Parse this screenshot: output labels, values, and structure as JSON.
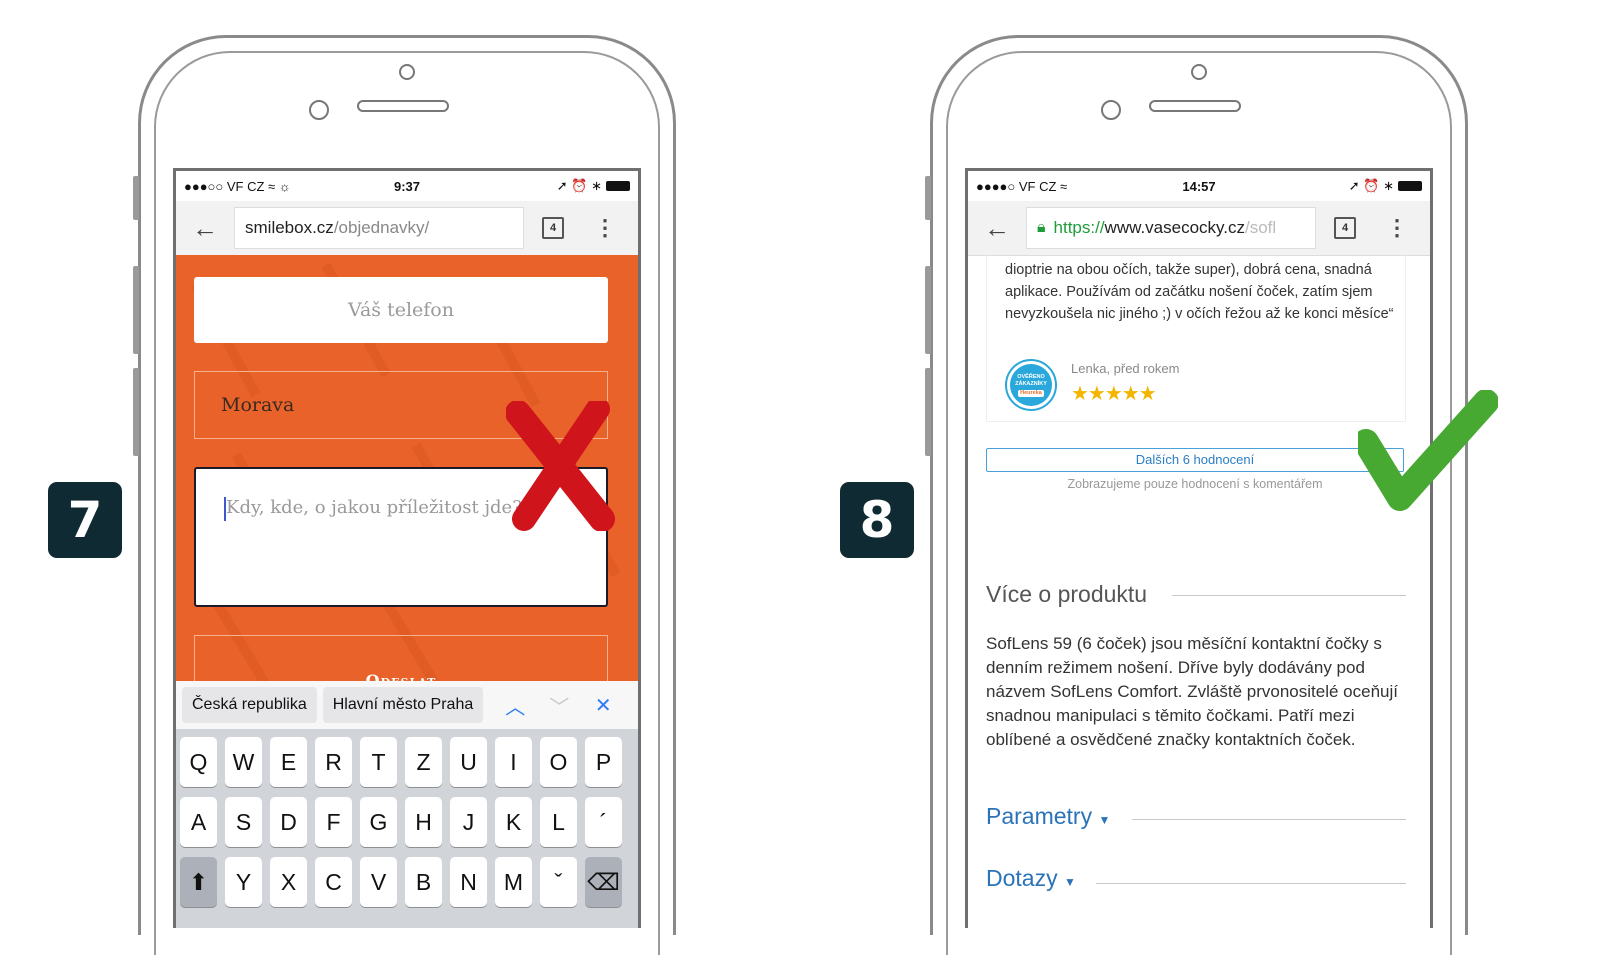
{
  "steps": {
    "left": "7",
    "right": "8"
  },
  "left_phone": {
    "status": {
      "carrier": "●●●○○ VF CZ ≈ ☼",
      "time": "9:37",
      "right": "➚ ⏰ ∗"
    },
    "url": {
      "host": "smilebox.cz",
      "path": "/objednavky/"
    },
    "tabs_count": "4",
    "form": {
      "phone_placeholder": "Váš telefon",
      "region_value": "Morava",
      "message_placeholder": "Kdy, kde, o jakou příležitost jde?",
      "send_label": "Odeslat"
    },
    "autofill": [
      "Česká republika",
      "Hlavní město Praha"
    ],
    "keyboard": {
      "row1": [
        "Q",
        "W",
        "E",
        "R",
        "T",
        "Z",
        "U",
        "I",
        "O",
        "P"
      ],
      "row2": [
        "A",
        "S",
        "D",
        "F",
        "G",
        "H",
        "J",
        "K",
        "L",
        "´"
      ],
      "row3": [
        "⬆",
        "Y",
        "X",
        "C",
        "V",
        "B",
        "N",
        "M",
        "ˇ",
        "⌫"
      ]
    },
    "accent": "#e8622a"
  },
  "right_phone": {
    "status": {
      "carrier": "●●●●○ VF CZ ≈",
      "time": "14:57",
      "right": "➚ ⏰ ∗"
    },
    "url": {
      "scheme": "https://",
      "host": "www.vasecocky.cz",
      "path": "/sofl"
    },
    "tabs_count": "4",
    "review": {
      "text": "dioptrie na obou očích, takže super), dobrá cena, snadná aplikace. Používám od začátku nošení čoček, zatím sjem nevyzkoušela nic jiného ;) v očích řežou až ke konci měsíce“",
      "seal_lines": [
        "OVĚŘENO",
        "ZÁKAZNÍKY",
        "Heureka"
      ],
      "author": "Lenka, před rokem",
      "stars": "★★★★★",
      "rating": 5
    },
    "more_reviews": "Dalších 6 hodnocení",
    "more_note": "Zobrazujeme pouze hodnocení s komentářem",
    "section_more": "Více o produktu",
    "description": "SofLens 59 (6 čoček) jsou měsíční kontaktní čočky s denním režimem nošení. Dříve byly dodávány pod názvem SofLens Comfort. Zvláště prvonositelé oceňují snadnou manipulaci s těmito čočkami. Patří mezi oblíbené a osvědčené značky kontaktních čoček.",
    "section_params": "Parametry",
    "section_questions": "Dotazy",
    "link_color": "#2a73b8"
  },
  "marks": {
    "bad": "red-x-icon",
    "good": "green-check-icon",
    "bad_color": "#d0141b",
    "good_color": "#47a832"
  }
}
